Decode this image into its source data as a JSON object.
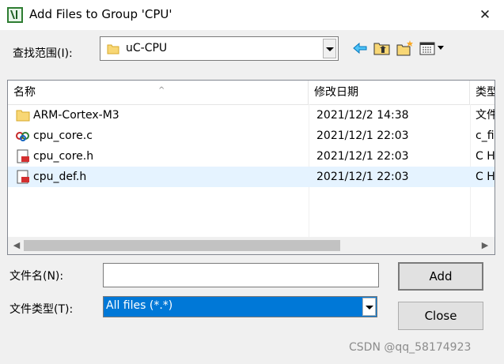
{
  "window": {
    "title": "Add Files to Group 'CPU'",
    "close_glyph": "✕"
  },
  "look_in": {
    "label": "查找范围(I):",
    "value": "uC-CPU"
  },
  "toolbar": {
    "back_icon": "back-arrow-icon",
    "up_icon": "up-folder-icon",
    "new_folder_icon": "new-folder-icon",
    "view_menu_icon": "view-menu-icon"
  },
  "list": {
    "columns": {
      "name": "名称",
      "date": "修改日期",
      "type": "类型"
    },
    "rows": [
      {
        "name": "ARM-Cortex-M3",
        "date": "2021/12/2 14:38",
        "type": "文件夹",
        "icon": "folder-icon"
      },
      {
        "name": "cpu_core.c",
        "date": "2021/12/1 22:03",
        "type": "c_file",
        "icon": "c-source-icon"
      },
      {
        "name": "cpu_core.h",
        "date": "2021/12/1 22:03",
        "type": "C Header",
        "icon": "header-file-icon"
      },
      {
        "name": "cpu_def.h",
        "date": "2021/12/1 22:03",
        "type": "C Header",
        "icon": "header-file-icon"
      }
    ],
    "selected_row": 3
  },
  "filename": {
    "label": "文件名(N):",
    "value": ""
  },
  "filetype": {
    "label": "文件类型(T):",
    "value": "All files (*.*)"
  },
  "buttons": {
    "add": "Add",
    "close": "Close"
  },
  "watermark": "CSDN @qq_58174923",
  "colors": {
    "accent": "#0078d7",
    "selection": "#e5f3ff"
  }
}
